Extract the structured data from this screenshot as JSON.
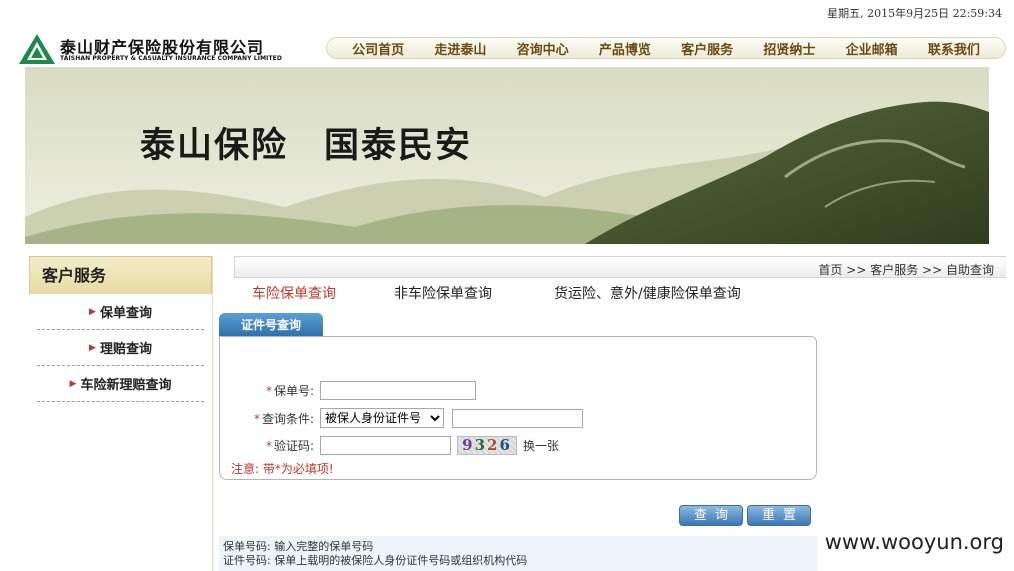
{
  "datetime": "星期五, 2015年9月25日 22:59:34",
  "logo": {
    "name_cn": "泰山财产保险股份有限公司",
    "name_en": "TAISHAN PROPERTY & CASUALTY INSURANCE COMPANY LIMITED"
  },
  "topnav": [
    {
      "label": "公司首页"
    },
    {
      "label": "走进泰山"
    },
    {
      "label": "咨询中心"
    },
    {
      "label": "产品博览"
    },
    {
      "label": "客户服务"
    },
    {
      "label": "招贤纳士"
    },
    {
      "label": "企业邮箱"
    },
    {
      "label": "联系我们"
    }
  ],
  "banner": {
    "slogan_1": "泰山保险",
    "slogan_2": "国泰民安"
  },
  "sidebar": {
    "title": "客户服务",
    "items": [
      {
        "label": "保单查询"
      },
      {
        "label": "理赔查询"
      },
      {
        "label": "车险新理赔查询"
      }
    ]
  },
  "breadcrumb": {
    "home": "首页",
    "sep_1": ">>",
    "section": "客户服务",
    "sep_2": ">>",
    "current": "自助查询"
  },
  "query_tabs": [
    {
      "label": "车险保单查询",
      "active": true
    },
    {
      "label": "非车险保单查询",
      "active": false
    },
    {
      "label": "货运险、意外/健康险保单查询",
      "active": false
    }
  ],
  "form": {
    "tab_label": "证件号查询",
    "required_mark": "*",
    "policy_no_label": "保单号:",
    "policy_no_value": "",
    "condition_label": "查询条件:",
    "condition_selected": "被保人身份证件号",
    "condition_value": "",
    "captcha_label": "验证码:",
    "captcha_value": "",
    "captcha_digits": [
      "9",
      "3",
      "2",
      "6"
    ],
    "refresh_label": "换一张",
    "note": "注意: 带*为必填项!"
  },
  "buttons": {
    "query": "查询",
    "reset": "重置"
  },
  "help": {
    "line_1": "保单号码: 输入完整的保单号码",
    "line_2": "证件号码: 保单上载明的被保险人身份证件号码或组织机构代码"
  },
  "watermark": "www.wooyun.org",
  "colors": {
    "accent_red": "#c0392b",
    "nav_text": "#6b4a12",
    "tab_blue": "#2c6ea7"
  }
}
